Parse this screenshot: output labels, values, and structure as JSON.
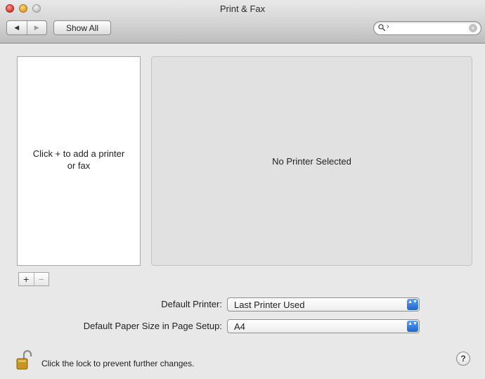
{
  "window": {
    "title": "Print & Fax"
  },
  "toolbar": {
    "back_glyph": "◀",
    "forward_glyph": "▶",
    "show_all_label": "Show All"
  },
  "search": {
    "value": "",
    "placeholder": "",
    "caret_glyph": "›",
    "clear_glyph": "×"
  },
  "printer_list": {
    "empty_text": "Click + to add a printer or fax"
  },
  "detail": {
    "empty_text": "No Printer Selected"
  },
  "list_controls": {
    "add_label": "+",
    "remove_label": "−"
  },
  "default_printer": {
    "label": "Default Printer:",
    "value": "Last Printer Used"
  },
  "paper_size": {
    "label": "Default Paper Size in Page Setup:",
    "value": "A4"
  },
  "stepper_glyph": "▲▼",
  "footer": {
    "lock_text": "Click the lock to prevent further changes.",
    "help_label": "?"
  },
  "colors": {
    "popup_accent": "#2c74dc",
    "lock_gold": "#c9941f"
  },
  "icons": {
    "search": "magnifier-icon",
    "lock": "padlock-open-icon",
    "help": "question-mark-icon"
  }
}
